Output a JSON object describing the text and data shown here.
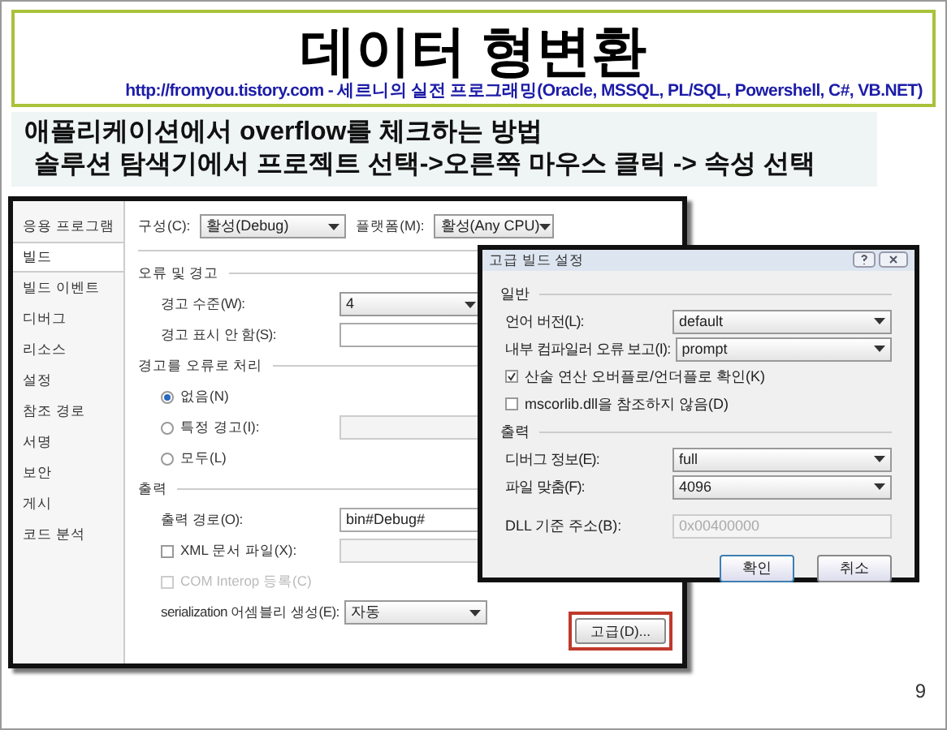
{
  "slide": {
    "title": "데이터 형변환",
    "subtitle": "http://fromyou.tistory.com - 세르니의 실전 프로그래밍(Oracle, MSSQL, PL/SQL, Powershell, C#, VB.NET)",
    "instructions": [
      "애플리케이션에서 overflow를 체크하는  방법",
      "솔루션 탐색기에서 프로젝트 선택->오른쪽 마우스 클릭 -> 속성 선택"
    ],
    "page_number": "9"
  },
  "properties": {
    "tabs": [
      {
        "label": "응용 프로그램",
        "selected": false
      },
      {
        "label": "빌드",
        "selected": true
      },
      {
        "label": "빌드 이벤트",
        "selected": false
      },
      {
        "label": "디버그",
        "selected": false
      },
      {
        "label": "리소스",
        "selected": false
      },
      {
        "label": "설정",
        "selected": false
      },
      {
        "label": "참조 경로",
        "selected": false
      },
      {
        "label": "서명",
        "selected": false
      },
      {
        "label": "보안",
        "selected": false
      },
      {
        "label": "게시",
        "selected": false
      },
      {
        "label": "코드 분석",
        "selected": false
      }
    ],
    "top_bar": [
      {
        "label": "구성(C):",
        "value": "활성(Debug)"
      },
      {
        "label": "플랫폼(M):",
        "value": "활성(Any CPU)"
      }
    ],
    "rows": [
      {
        "kind": "section",
        "label": "오류 및 경고"
      },
      {
        "kind": "dropdown",
        "label": "경고 수준(W):",
        "value": "4"
      },
      {
        "kind": "text",
        "label": "경고 표시 안 함(S):"
      },
      {
        "kind": "section",
        "label": "경고를 오류로 처리"
      },
      {
        "kind": "radio",
        "label": "없음(N)",
        "selected": true
      },
      {
        "kind": "radio-field",
        "label": "특정 경고(I):",
        "selected": false
      },
      {
        "kind": "radio",
        "label": "모두(L)",
        "selected": false
      },
      {
        "kind": "section",
        "label": "출력"
      },
      {
        "kind": "text",
        "label": "출력 경로(O):",
        "value": "bin#Debug#"
      },
      {
        "kind": "checkbox-field",
        "label": "XML 문서 파일(X):",
        "checked": false,
        "disabled": false
      },
      {
        "kind": "checkbox",
        "label": "COM Interop 등록(C)",
        "checked": false,
        "disabled": true
      },
      {
        "kind": "dropdown",
        "label": "serialization 어셈블리 생성(E):",
        "value": "자동"
      }
    ],
    "advanced_button": {
      "label": "고급(D)...",
      "highlighted": true
    }
  },
  "dialog": {
    "title": "고급 빌드 설정",
    "rows": [
      {
        "kind": "section",
        "label": "일반"
      },
      {
        "kind": "dropdown",
        "label": "언어 버전(L):",
        "value": "default"
      },
      {
        "kind": "dropdown",
        "label": "내부 컴파일러 오류 보고(I):",
        "value": "prompt"
      },
      {
        "kind": "checkbox",
        "label": "산술 연산 오버플로/언더플로 확인(K)",
        "checked": true
      },
      {
        "kind": "checkbox",
        "label": "mscorlib.dll을 참조하지 않음(D)",
        "checked": false
      },
      {
        "kind": "section",
        "label": "출력"
      },
      {
        "kind": "dropdown",
        "label": "디버그 정보(E):",
        "value": "full"
      },
      {
        "kind": "dropdown",
        "label": "파일 맞춤(F):",
        "value": "4096"
      },
      {
        "kind": "text",
        "label": "DLL 기준 주소(B):",
        "value": "0x00400000",
        "disabled": true
      }
    ],
    "buttons": [
      {
        "label": "확인",
        "default": true
      },
      {
        "label": "취소",
        "default": false
      }
    ]
  }
}
